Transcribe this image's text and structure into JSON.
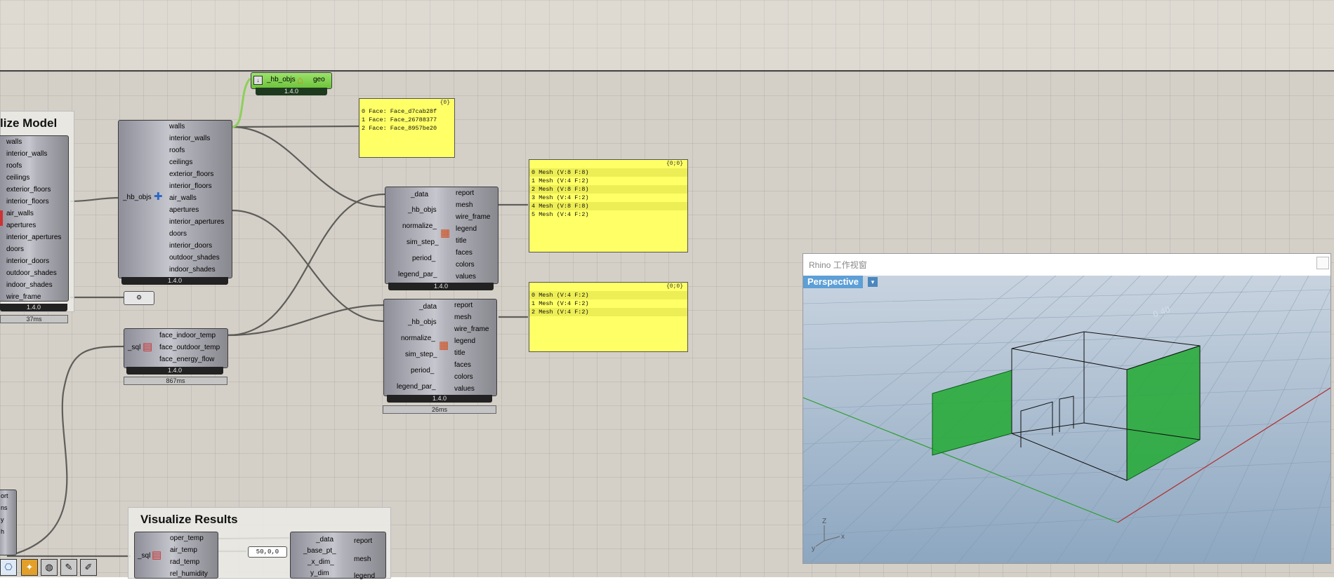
{
  "viz_model_group": {
    "title": "lize Model"
  },
  "left_list": {
    "outputs": [
      "walls",
      "interior_walls",
      "roofs",
      "ceilings",
      "exterior_floors",
      "interior_floors",
      "air_walls",
      "apertures",
      "interior_apertures",
      "doors",
      "interior_doors",
      "outdoor_shades",
      "indoor_shades",
      "wire_frame"
    ],
    "version": "1.4.0",
    "time": "37ms"
  },
  "geo_comp": {
    "input": "_hb_objs",
    "output": "geo",
    "version": "1.4.0"
  },
  "deconstruct_comp": {
    "input": "_hb_objs",
    "outputs": [
      "walls",
      "interior_walls",
      "roofs",
      "ceilings",
      "exterior_floors",
      "interior_floors",
      "air_walls",
      "apertures",
      "interior_apertures",
      "doors",
      "interior_doors",
      "outdoor_shades",
      "indoor_shades"
    ],
    "version": "1.4.0",
    "icon": "honeybee-icon"
  },
  "face_panel": {
    "header": "{0}",
    "rows": [
      "0 Face: Face_d7cab28f",
      "1 Face: Face_26788377",
      "2 Face: Face_8957be20"
    ]
  },
  "mesh_panel_1": {
    "header": "{0;0}",
    "rows": [
      "0 Mesh (V:8  F:8)",
      "1 Mesh (V:4  F:2)",
      "2 Mesh (V:8  F:8)",
      "3 Mesh (V:4  F:2)",
      "4 Mesh (V:8  F:8)",
      "5 Mesh (V:4  F:2)"
    ]
  },
  "mesh_panel_2": {
    "header": "{0;0}",
    "rows": [
      "0 Mesh (V:4  F:2)",
      "1 Mesh (V:4  F:2)",
      "2 Mesh (V:4  F:2)"
    ]
  },
  "color_comp_1": {
    "inputs": [
      "_data",
      "_hb_objs",
      "normalize_",
      "sim_step_",
      "period_",
      "legend_par_"
    ],
    "outputs": [
      "report",
      "mesh",
      "wire_frame",
      "legend",
      "title",
      "faces",
      "colors",
      "values"
    ],
    "version": "1.4.0"
  },
  "color_comp_2": {
    "inputs": [
      "_data",
      "_hb_objs",
      "normalize_",
      "sim_step_",
      "period_",
      "legend_par_"
    ],
    "outputs": [
      "report",
      "mesh",
      "wire_frame",
      "legend",
      "title",
      "faces",
      "colors",
      "values"
    ],
    "version": "1.4.0",
    "time": "26ms"
  },
  "sql_comp": {
    "input": "_sql",
    "outputs": [
      "face_indoor_temp",
      "face_outdoor_temp",
      "face_energy_flow"
    ],
    "version": "1.4.0",
    "time": "867ms"
  },
  "results_group": {
    "title": "Visualize Results",
    "sql_comp": {
      "input": "_sql",
      "outputs": [
        "oper_temp",
        "air_temp",
        "rad_temp",
        "rel_humidity"
      ]
    },
    "point_value": "50,0,0",
    "comp2": {
      "inputs": [
        "_data",
        "_base_pt_",
        "_x_dim_",
        "y_dim"
      ],
      "outputs": [
        "report",
        "mesh",
        "legend"
      ]
    }
  },
  "bottom_left_partial": [
    "ort",
    "ns",
    "y",
    "h"
  ],
  "viewport": {
    "title": "Rhino 工作视窗",
    "view_name": "Perspective",
    "axis_labels": {
      "z": "Z",
      "y": "y",
      "x": "x"
    },
    "colors": {
      "ground_top": "#c8d3df",
      "ground_bottom": "#8da7c1",
      "wall": "#22aa33",
      "x_axis": "#b03030",
      "y_axis": "#2e9e2e"
    }
  },
  "toolbar": [
    "python-icon",
    "fire-icon",
    "sphere-icon",
    "tag-icon",
    "pencil-icon"
  ]
}
